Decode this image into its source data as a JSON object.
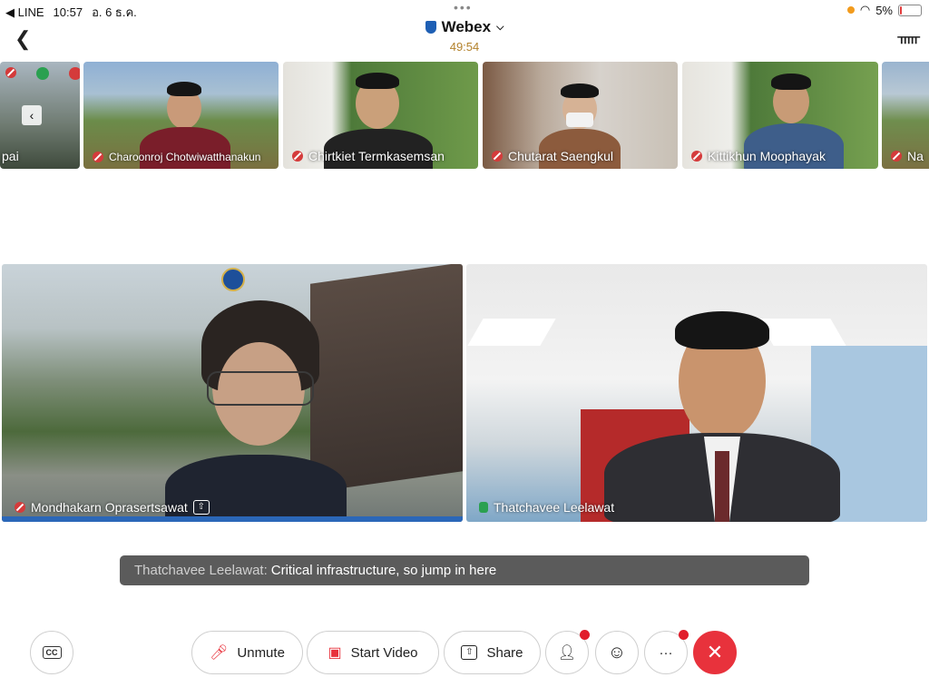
{
  "status": {
    "carrier": "◀ LINE",
    "time": "10:57",
    "date": "อ. 6 ธ.ค.",
    "battery": "5%",
    "battery_level": 0.05
  },
  "header": {
    "app_title": "Webex",
    "timer": "49:54"
  },
  "thumbnails": [
    {
      "name": "pai",
      "muted": false
    },
    {
      "name": "Charoonroj Chotwiwatthanakun",
      "muted": true
    },
    {
      "name": "Chirtkiet Termkasemsan",
      "muted": true
    },
    {
      "name": "Chutarat Saengkul",
      "muted": true
    },
    {
      "name": "Kittikhun Moophayak",
      "muted": true
    },
    {
      "name": "Na",
      "muted": true
    }
  ],
  "main_tiles": [
    {
      "name": "Mondhakarn Oprasertsawat",
      "muted": true,
      "sharing": true
    },
    {
      "name": "Thatchavee Leelawat",
      "muted": false,
      "sharing": false
    }
  ],
  "caption": {
    "speaker": "Thatchavee Leelawat:",
    "text": "Critical infrastructure, so jump in here"
  },
  "toolbar": {
    "cc_label": "CC",
    "unmute_label": "Unmute",
    "start_video_label": "Start Video",
    "share_label": "Share",
    "more_label": "···",
    "end_label": "✕"
  },
  "colors": {
    "accent_red": "#e8323c",
    "timer_gold": "#b3822c",
    "caption_bg": "#5b5b5b"
  }
}
